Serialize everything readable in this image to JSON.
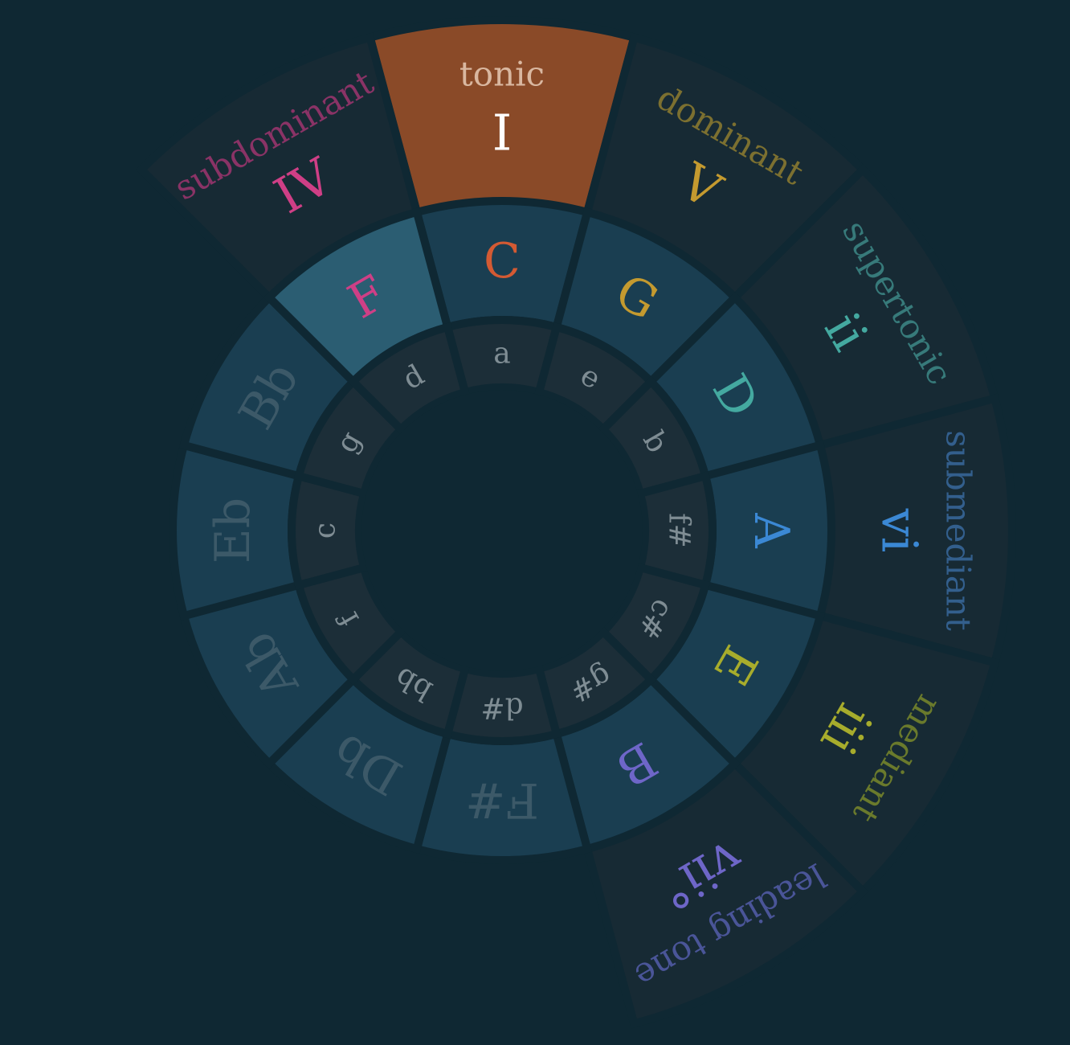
{
  "colors": {
    "background": "#0f2833",
    "gap": "#0f2833",
    "degree_ring": "#172a34",
    "major_ring": "#1a3e51",
    "minor_ring": "#1c2e38",
    "tonic_highlight": "#8a4a28",
    "subdominant_highlight": "#2b5d72"
  },
  "degrees": [
    {
      "numeral": "I",
      "name": "tonic",
      "numeral_color": "#ffffff",
      "name_color": "#d9b7a0",
      "active": true
    },
    {
      "numeral": "V",
      "name": "dominant",
      "numeral_color": "#c49a2f",
      "name_color": "#7c7030"
    },
    {
      "numeral": "ii",
      "name": "supertonic",
      "numeral_color": "#44a9a0",
      "name_color": "#377a7a"
    },
    {
      "numeral": "vi",
      "name": "submediant",
      "numeral_color": "#3b88d4",
      "name_color": "#335f8d"
    },
    {
      "numeral": "iii",
      "name": "mediant",
      "numeral_color": "#a7ac2c",
      "name_color": "#6a7a2c"
    },
    {
      "numeral": "vii°",
      "name": "leading tone",
      "numeral_color": "#6e66c8",
      "name_color": "#4a5598"
    },
    {
      "numeral": "IV",
      "name": "subdominant",
      "numeral_color": "#cf3f86",
      "name_color": "#8a3366"
    }
  ],
  "major_keys": [
    {
      "label": "C",
      "color": "#d35a33"
    },
    {
      "label": "G",
      "color": "#c49a2f"
    },
    {
      "label": "D",
      "color": "#44a9a0"
    },
    {
      "label": "A",
      "color": "#3b88d4"
    },
    {
      "label": "E",
      "color": "#a7ac2c"
    },
    {
      "label": "B",
      "color": "#6e66c8"
    },
    {
      "label": "F#",
      "color": "#3c5968"
    },
    {
      "label": "Db",
      "color": "#3c5968"
    },
    {
      "label": "Ab",
      "color": "#3c5968"
    },
    {
      "label": "Eb",
      "color": "#3c5968"
    },
    {
      "label": "Bb",
      "color": "#3c5968"
    },
    {
      "label": "F",
      "color": "#cf3f86",
      "highlighted": true
    }
  ],
  "minor_keys": [
    {
      "label": "a"
    },
    {
      "label": "e"
    },
    {
      "label": "b"
    },
    {
      "label": "f#"
    },
    {
      "label": "c#"
    },
    {
      "label": "g#"
    },
    {
      "label": "d#"
    },
    {
      "label": "bb"
    },
    {
      "label": "f"
    },
    {
      "label": "c"
    },
    {
      "label": "g"
    },
    {
      "label": "d"
    }
  ],
  "minor_text_color": "#7f8d94"
}
